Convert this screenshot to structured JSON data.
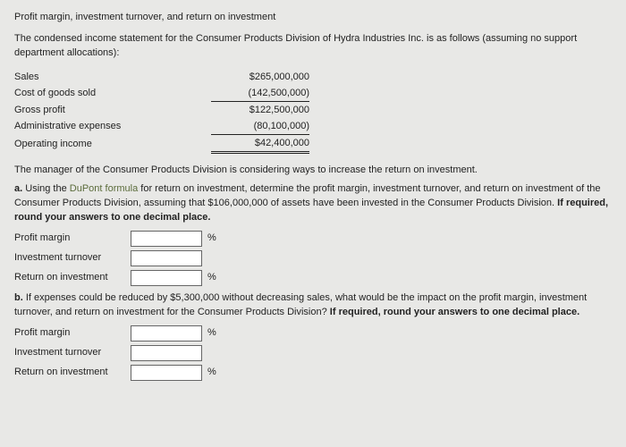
{
  "title_line": "Profit margin, investment turnover, and return on investment",
  "intro": "The condensed income statement for the Consumer Products Division of Hydra Industries Inc. is as follows (assuming no support department allocations):",
  "income": {
    "rows": [
      {
        "label": "Sales",
        "value": "$265,000,000",
        "style": ""
      },
      {
        "label": "Cost of goods sold",
        "value": "(142,500,000)",
        "style": "line-under"
      },
      {
        "label": "Gross profit",
        "value": "$122,500,000",
        "style": ""
      },
      {
        "label": "Administrative expenses",
        "value": "(80,100,000)",
        "style": "line-under"
      },
      {
        "label": "Operating income",
        "value": "$42,400,000",
        "style": "dbl-under"
      }
    ]
  },
  "manager_line": "The manager of the Consumer Products Division is considering ways to increase the return on investment.",
  "part_a": {
    "letter": "a.",
    "text_1": "Using the ",
    "link": "DuPont formula",
    "text_2": " for return on investment, determine the profit margin, investment turnover, and return on investment of the Consumer Products Division, assuming that $106,000,000 of assets have been invested in the Consumer Products Division. ",
    "bold_tail": "If required, round your answers to one decimal place."
  },
  "answers_a": [
    {
      "label": "Profit margin",
      "unit": "%"
    },
    {
      "label": "Investment turnover",
      "unit": ""
    },
    {
      "label": "Return on investment",
      "unit": "%"
    }
  ],
  "part_b": {
    "letter": "b.",
    "text": "If expenses could be reduced by $5,300,000 without decreasing sales, what would be the impact on the profit margin, investment turnover, and return on investment for the Consumer Products Division? ",
    "bold_tail": "If required, round your answers to one decimal place."
  },
  "answers_b": [
    {
      "label": "Profit margin",
      "unit": "%"
    },
    {
      "label": "Investment turnover",
      "unit": ""
    },
    {
      "label": "Return on investment",
      "unit": "%"
    }
  ]
}
